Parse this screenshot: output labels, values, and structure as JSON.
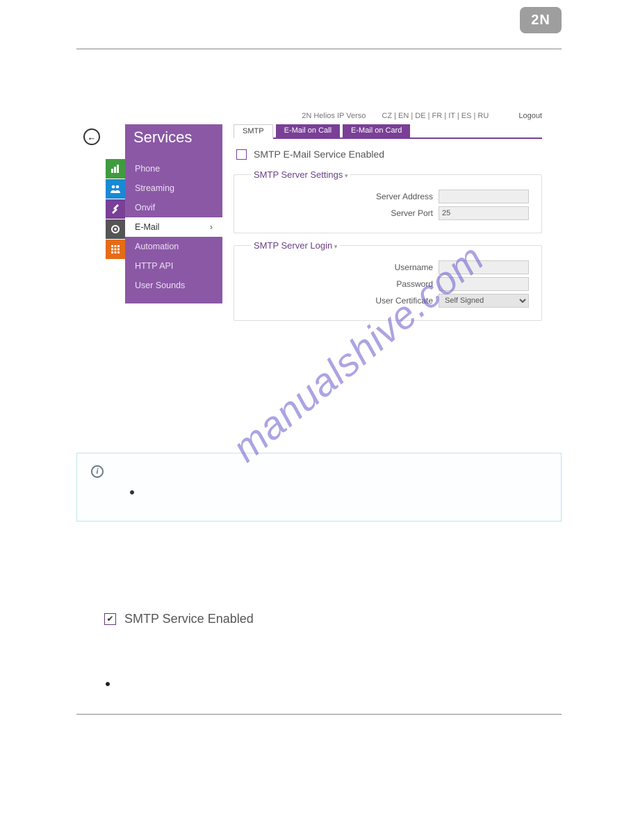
{
  "brand": "2N",
  "watermark": "manualshive.com",
  "header": {
    "product": "2N Helios IP Verso",
    "languages": "CZ | EN | DE | FR | IT | ES | RU",
    "logout": "Logout"
  },
  "sidebar": {
    "title": "Services",
    "items": [
      "Phone",
      "Streaming",
      "Onvif",
      "E-Mail",
      "Automation",
      "HTTP API",
      "User Sounds"
    ],
    "active_index": 3
  },
  "icon_strip": [
    "bars-icon",
    "users-icon",
    "tools-icon",
    "gear-icon",
    "grid-icon"
  ],
  "tabs": {
    "items": [
      "SMTP",
      "E-Mail on Call",
      "E-Mail on Card"
    ],
    "active_index": 0
  },
  "checkbox_main": "SMTP E-Mail Service Enabled",
  "group_server": {
    "legend": "SMTP Server Settings",
    "rows": [
      {
        "label": "Server Address",
        "value": ""
      },
      {
        "label": "Server Port",
        "value": "25"
      }
    ]
  },
  "group_login": {
    "legend": "SMTP Server Login",
    "rows": [
      {
        "label": "Username",
        "value": ""
      },
      {
        "label": "Password",
        "value": ""
      }
    ],
    "select": {
      "label": "User Certificate",
      "value": "Self Signed"
    }
  },
  "standalone_label": "SMTP Service Enabled"
}
